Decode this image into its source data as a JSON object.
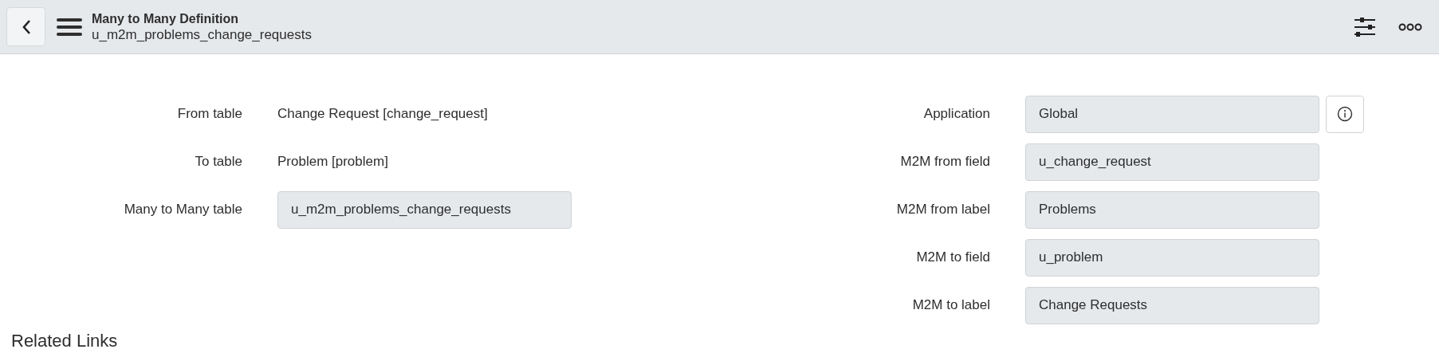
{
  "header": {
    "title": "Many to Many Definition",
    "subtitle": "u_m2m_problems_change_requests"
  },
  "left_fields": [
    {
      "label": "From table",
      "kind": "text",
      "value": "Change Request [change_request]"
    },
    {
      "label": "To table",
      "kind": "text",
      "value": "Problem [problem]"
    },
    {
      "label": "Many to Many table",
      "kind": "field",
      "value": "u_m2m_problems_change_requests"
    }
  ],
  "right_fields": [
    {
      "label": "Application",
      "kind": "field",
      "value": "Global",
      "info": true
    },
    {
      "label": "M2M from field",
      "kind": "field",
      "value": "u_change_request",
      "info": false
    },
    {
      "label": "M2M from label",
      "kind": "field",
      "value": "Problems",
      "info": false
    },
    {
      "label": "M2M to field",
      "kind": "field",
      "value": "u_problem",
      "info": false
    },
    {
      "label": "M2M to label",
      "kind": "field",
      "value": "Change Requests",
      "info": false
    }
  ],
  "related_links": {
    "heading": "Related Links"
  }
}
